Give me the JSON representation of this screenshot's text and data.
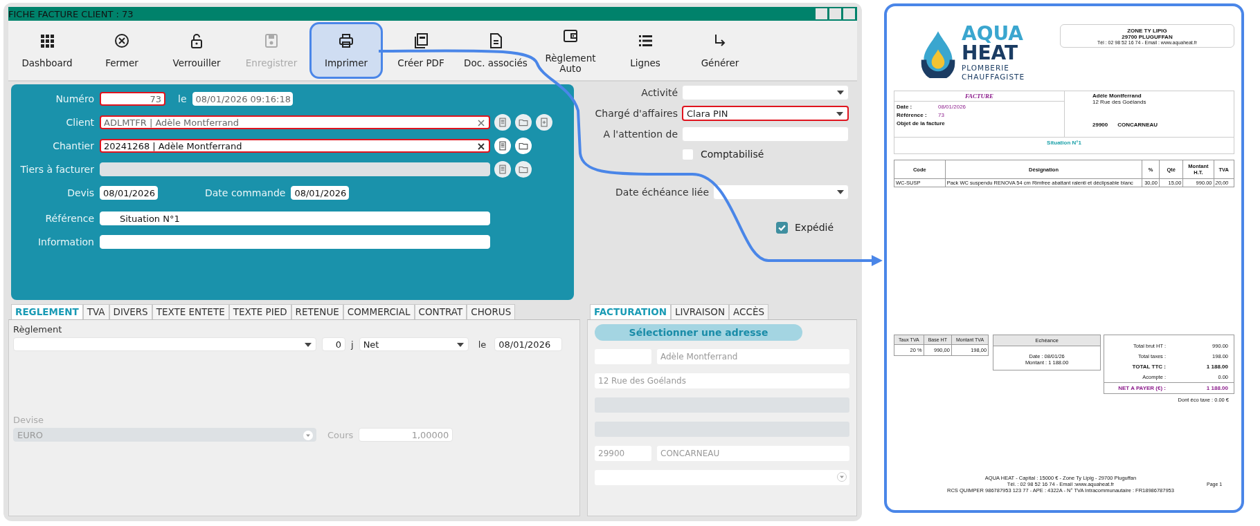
{
  "window": {
    "title": "FICHE FACTURE CLIENT : 73"
  },
  "toolbar": [
    {
      "label": "Dashboard",
      "disabled": false,
      "highlighted": false
    },
    {
      "label": "Fermer",
      "disabled": false,
      "highlighted": false
    },
    {
      "label": "Verrouiller",
      "disabled": false,
      "highlighted": false
    },
    {
      "label": "Enregistrer",
      "disabled": true,
      "highlighted": false
    },
    {
      "label": "Imprimer",
      "disabled": false,
      "highlighted": true
    },
    {
      "label": "Créer PDF",
      "disabled": false,
      "highlighted": false
    },
    {
      "label": "Doc. associés",
      "disabled": false,
      "highlighted": false
    },
    {
      "label": "Règlement Auto",
      "disabled": false,
      "highlighted": false
    },
    {
      "label": "Lignes",
      "disabled": false,
      "highlighted": false
    },
    {
      "label": "Générer",
      "disabled": false,
      "highlighted": false
    }
  ],
  "main_form": {
    "numero": {
      "label": "Numéro",
      "value": "73",
      "required": true
    },
    "date": {
      "label": "le",
      "value": "08/01/2026 09:16:18"
    },
    "client": {
      "label": "Client",
      "value": "ADLMTFR | Adèle Montferrand",
      "required": true,
      "disabled": true
    },
    "chantier": {
      "label": "Chantier",
      "value": "20241268 | Adèle Montferrand",
      "required": true,
      "disabled": false
    },
    "tiers": {
      "label": "Tiers à facturer"
    },
    "devis": {
      "label": "Devis",
      "value": "08/01/2026"
    },
    "date_commande": {
      "label": "Date commande",
      "value": "08/01/2026"
    },
    "reference": {
      "label": "Référence",
      "value": "Situation N°1"
    },
    "information": {
      "label": "Information"
    }
  },
  "side_form": {
    "activite": {
      "label": "Activité"
    },
    "charge": {
      "label": "Chargé d'affaires",
      "value": "Clara PIN",
      "required": true
    },
    "attention": {
      "label": "A l'attention de"
    },
    "comptabilise": {
      "label": "Comptabilisé",
      "checked": false
    },
    "date_echeance": {
      "label": "Date échéance liée"
    },
    "expedie": {
      "label": "Expédié",
      "checked": true
    }
  },
  "left_tabs": [
    {
      "label": "REGLEMENT",
      "selected": true
    },
    {
      "label": "TVA",
      "selected": false
    },
    {
      "label": "DIVERS",
      "selected": false
    },
    {
      "label": "TEXTE ENTETE",
      "selected": false
    },
    {
      "label": "TEXTE PIED",
      "selected": false
    },
    {
      "label": "RETENUE",
      "selected": false
    },
    {
      "label": "COMMERCIAL",
      "selected": false
    },
    {
      "label": "CONTRAT",
      "selected": false
    },
    {
      "label": "CHORUS",
      "selected": false
    }
  ],
  "reglement": {
    "label": "Règlement",
    "days": "0",
    "days_unit": "j",
    "term": "Net",
    "date_label": "le",
    "date": "08/01/2026",
    "devise_label": "Devise",
    "devise": "EURO",
    "cours_label": "Cours",
    "cours": "1,00000"
  },
  "right_tabs": [
    {
      "label": "FACTURATION",
      "selected": true
    },
    {
      "label": "LIVRAISON",
      "selected": false
    },
    {
      "label": "ACCÈS",
      "selected": false
    }
  ],
  "address": {
    "button": "Sélectionner une adresse",
    "name": "Adèle Montferrand",
    "street": "12 Rue des Goélands",
    "postcode": "29900",
    "city": "CONCARNEAU"
  },
  "invoice": {
    "logo": {
      "line1": "AQUA",
      "line2": "HEAT",
      "line3": "PLOMBERIE",
      "line4": "CHAUFFAGISTE"
    },
    "company": [
      "ZONE TY LIPIG",
      "29700 PLUGUFFAN",
      "Tél : 02 98 52 16 74  -  Email : www.aquaheat.fr"
    ],
    "title": "FACTURE",
    "date_label": "Date :",
    "date": "08/01/2026",
    "ref_label": "Référence :",
    "ref": "73",
    "object_label": "Objet de la facture",
    "object": "Situation N°1",
    "recipient": {
      "name": "Adèle Montferrand",
      "street": "12 Rue des Goélands",
      "postcode": "29900",
      "city": "CONCARNEAU"
    },
    "lines": {
      "columns": [
        "Code",
        "Désignation",
        "%",
        "Qté",
        "Montant H.T.",
        "TVA"
      ],
      "rows": [
        [
          "WC-SUSP",
          "Pack WC suspendu RENOVA 54 cm Rimfree abattant ralenti et déclipsable blanc",
          "30,00",
          "15,00",
          "990.00",
          "20,00"
        ]
      ]
    },
    "vat": {
      "columns": [
        "Taux TVA",
        "Base HT",
        "Montant TVA"
      ],
      "rows": [
        [
          "20 %",
          "990,00",
          "198,00"
        ]
      ]
    },
    "due": {
      "title": "Echéance",
      "date": "Date : 08/01/26",
      "amount": "Montant : 1 188.00"
    },
    "totals": [
      {
        "label": "Total brut HT :",
        "value": "990.00",
        "kind": "normal"
      },
      {
        "label": "Total taxes :",
        "value": "198.00",
        "kind": "normal"
      },
      {
        "label": "TOTAL TTC :",
        "value": "1 188.00",
        "kind": "strong"
      },
      {
        "label": "Acompte :",
        "value": "0.00",
        "kind": "normal"
      },
      {
        "label": "NET A PAYER (€) :",
        "value": "1 188.00",
        "kind": "net"
      }
    ],
    "eco_tax": "Dont éco taxe : 0.00 €",
    "footer": [
      "AQUA HEAT  -  Capital : 15000 €  -  Zone Ty Lipig - 29700 Pluguffan",
      "Tél. : 02 98 52 16 74 - Email :www.aquaheat.fr",
      "RCS QUIMPER 986787953 123 77  -  APE : 4322A  -  N° TVA Intracommunautaire : FR18986787953"
    ],
    "page": "Page 1"
  }
}
